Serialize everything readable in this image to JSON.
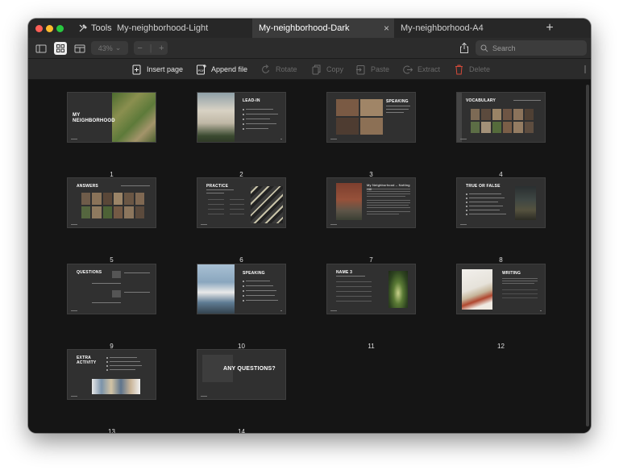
{
  "tabs": {
    "tools_label": "Tools",
    "items": [
      {
        "label": "My-neighborhood-Light"
      },
      {
        "label": "My-neighborhood-Dark"
      },
      {
        "label": "My-neighborhood-A4"
      }
    ],
    "close_glyph": "×",
    "new_tab_glyph": "+"
  },
  "toolbar": {
    "zoom_label": "43%",
    "stepper_minus": "−",
    "stepper_plus": "+",
    "search_placeholder": "Search"
  },
  "actions": {
    "insert_page": "Insert page",
    "append_file": "Append file",
    "rotate": "Rotate",
    "copy": "Copy",
    "paste": "Paste",
    "extract": "Extract",
    "delete": "Delete"
  },
  "pages": [
    {
      "number": "1",
      "title": "MY NEIGHBORHOOD"
    },
    {
      "number": "2",
      "title": "LEAD-IN"
    },
    {
      "number": "3",
      "title": "SPEAKING"
    },
    {
      "number": "4",
      "title": "VOCABULARY"
    },
    {
      "number": "5",
      "title": "ANSWERS"
    },
    {
      "number": "6",
      "title": "PRACTICE"
    },
    {
      "number": "7",
      "title": "My Neighborhood – Notting Hill"
    },
    {
      "number": "8",
      "title": "TRUE OR FALSE"
    },
    {
      "number": "9",
      "title": "QUESTIONS"
    },
    {
      "number": "10",
      "title": "SPEAKING"
    },
    {
      "number": "11",
      "title": "NAME 3"
    },
    {
      "number": "12",
      "title": "WRITING"
    },
    {
      "number": "13",
      "title": "EXTRA ACTIVITY"
    },
    {
      "number": "14",
      "title": "ANY QUESTIONS?"
    }
  ],
  "colors": {
    "window_bg": "#151515",
    "slide_bg": "#303030",
    "active_tab": "#3b3b3b",
    "delete_icon": "#d44a3a"
  }
}
